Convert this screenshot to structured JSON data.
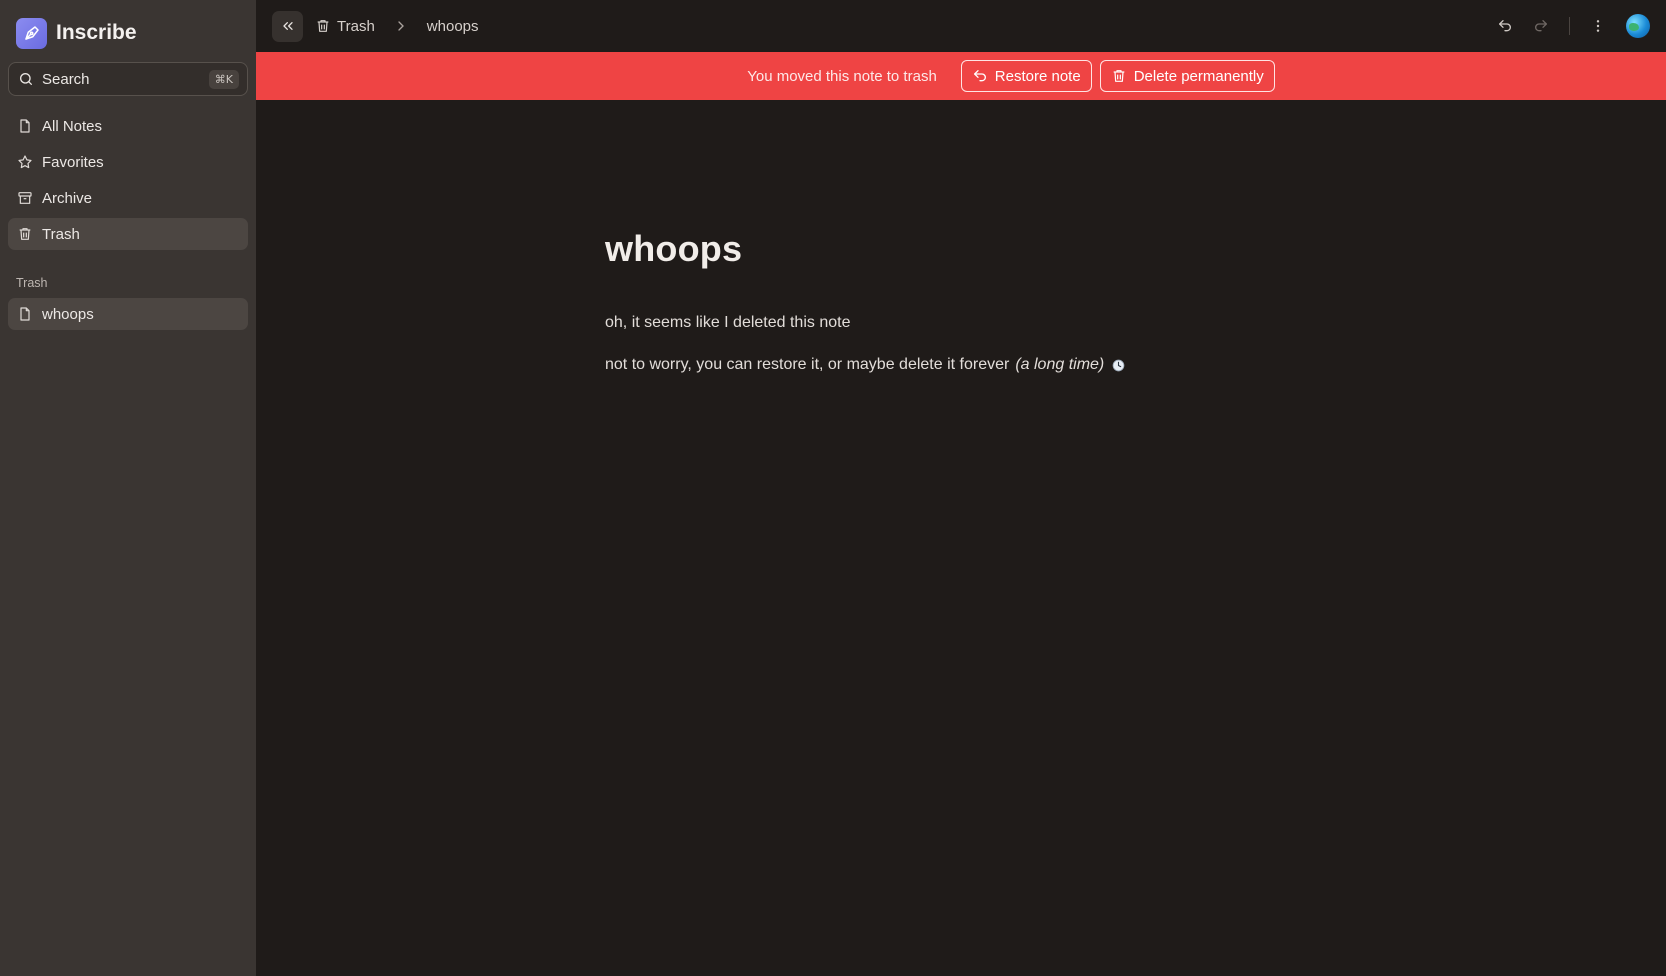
{
  "app": {
    "name": "Inscribe"
  },
  "sidebar": {
    "search": {
      "label": "Search",
      "shortcut": "⌘K"
    },
    "nav": [
      {
        "label": "All Notes",
        "icon": "file-icon"
      },
      {
        "label": "Favorites",
        "icon": "star-icon"
      },
      {
        "label": "Archive",
        "icon": "archive-icon"
      },
      {
        "label": "Trash",
        "icon": "trash-icon",
        "active": true
      }
    ],
    "section": {
      "label": "Trash"
    },
    "notes": [
      {
        "label": "whoops",
        "icon": "file-icon",
        "active": true
      }
    ]
  },
  "topbar": {
    "breadcrumb": {
      "parent": "Trash",
      "current": "whoops"
    }
  },
  "banner": {
    "message": "You moved this note to trash",
    "restore_label": "Restore note",
    "delete_label": "Delete permanently",
    "color": "#ef4444"
  },
  "document": {
    "title": "whoops",
    "paragraph1": "oh, it seems like I deleted this note",
    "paragraph2_text": "not to worry, you can restore it, or maybe delete it forever",
    "paragraph2_italic": "(a long time)"
  }
}
